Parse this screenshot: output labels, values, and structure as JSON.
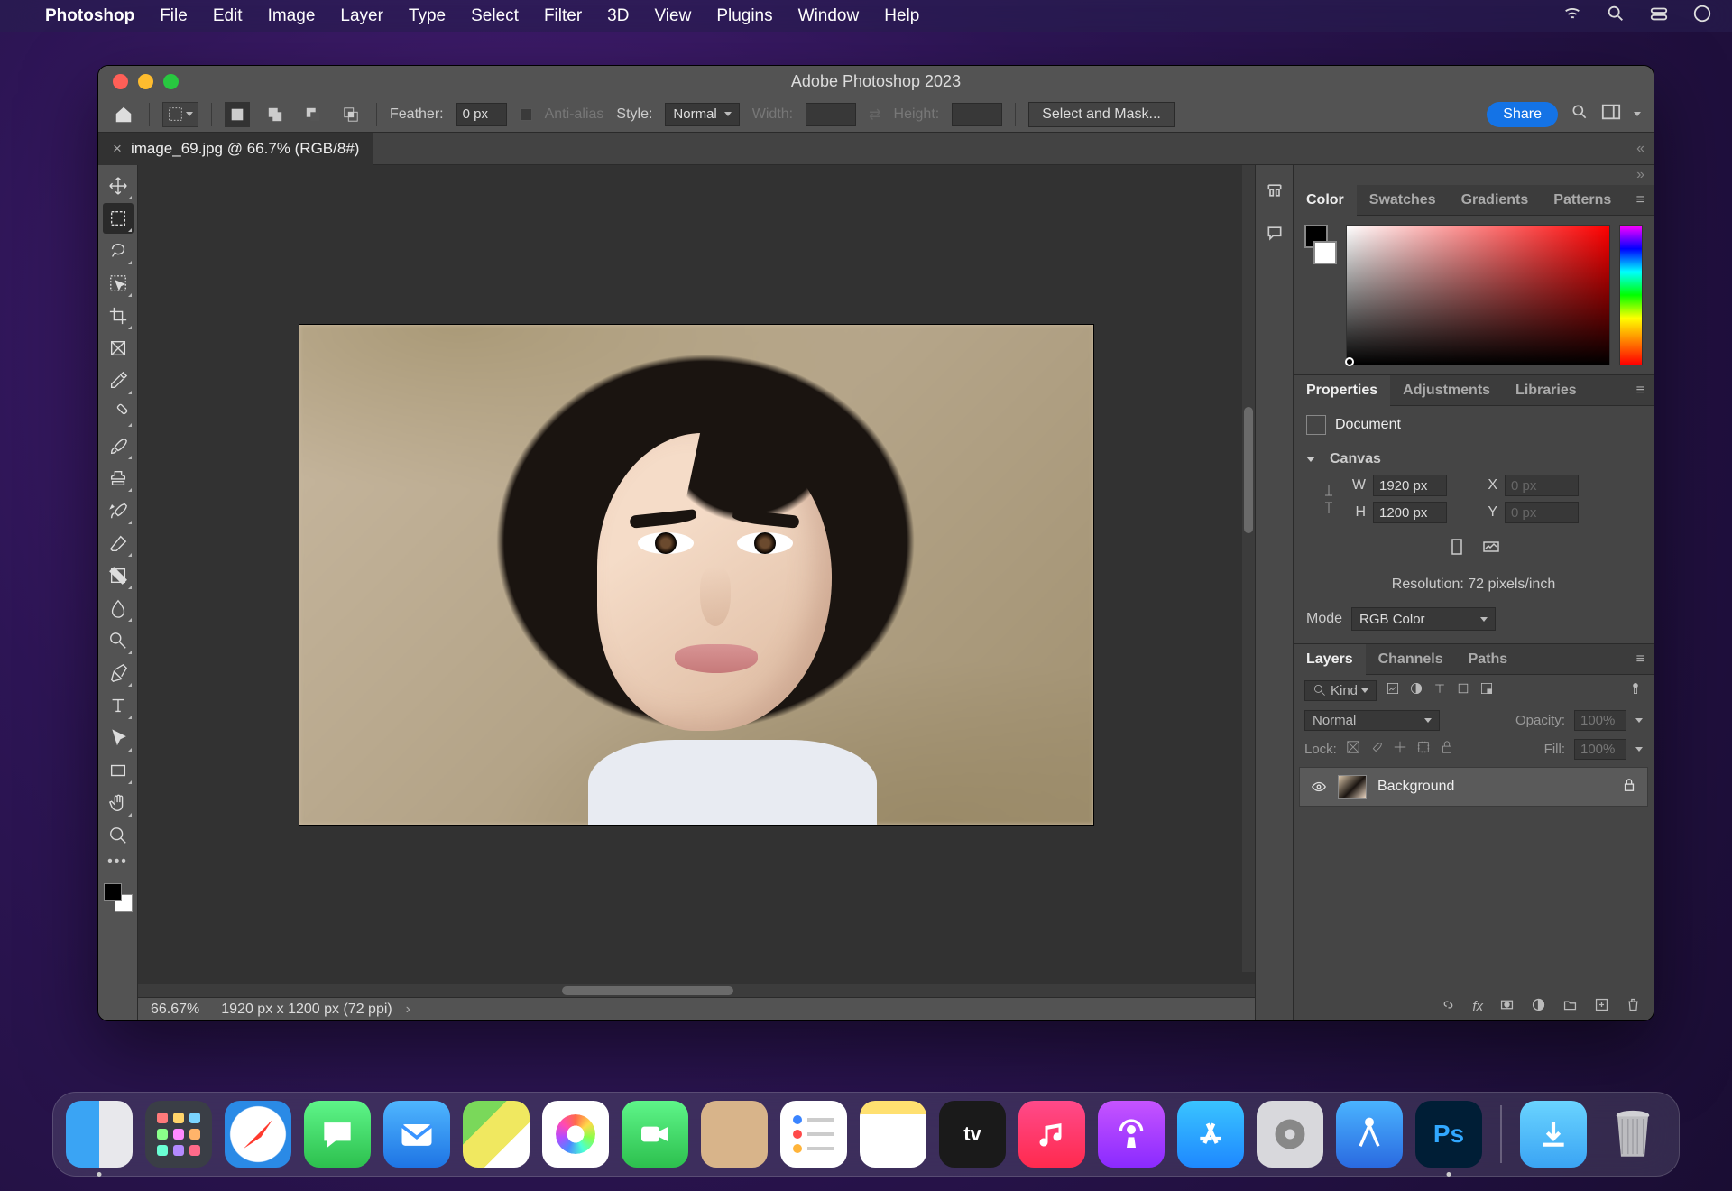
{
  "mac_menubar": {
    "app_name": "Photoshop",
    "items": [
      "File",
      "Edit",
      "Image",
      "Layer",
      "Type",
      "Select",
      "Filter",
      "3D",
      "View",
      "Plugins",
      "Window",
      "Help"
    ]
  },
  "window_title": "Adobe Photoshop 2023",
  "options_bar": {
    "feather_label": "Feather:",
    "feather_value": "0 px",
    "anti_alias_label": "Anti-alias",
    "style_label": "Style:",
    "style_value": "Normal",
    "width_label": "Width:",
    "height_label": "Height:",
    "select_mask_label": "Select and Mask...",
    "share_label": "Share"
  },
  "document_tab": {
    "title": "image_69.jpg @ 66.7% (RGB/8#)"
  },
  "statusbar": {
    "zoom": "66.67%",
    "dims": "1920 px x 1200 px (72 ppi)"
  },
  "panels": {
    "color_tabs": [
      "Color",
      "Swatches",
      "Gradients",
      "Patterns"
    ],
    "props_tabs": [
      "Properties",
      "Adjustments",
      "Libraries"
    ],
    "props_header": "Document",
    "canvas_label": "Canvas",
    "w_label": "W",
    "h_label": "H",
    "x_label": "X",
    "y_label": "Y",
    "w_value": "1920 px",
    "h_value": "1200 px",
    "x_value": "0 px",
    "y_value": "0 px",
    "resolution_label": "Resolution: 72 pixels/inch",
    "mode_label": "Mode",
    "mode_value": "RGB Color",
    "layers_tabs": [
      "Layers",
      "Channels",
      "Paths"
    ],
    "kind_label": "Kind",
    "blend_value": "Normal",
    "opacity_label": "Opacity:",
    "opacity_value": "100%",
    "lock_label": "Lock:",
    "fill_label": "Fill:",
    "fill_value": "100%",
    "layer_name": "Background"
  },
  "dock": {
    "tv_label": "tv",
    "ps_label": "Ps"
  }
}
